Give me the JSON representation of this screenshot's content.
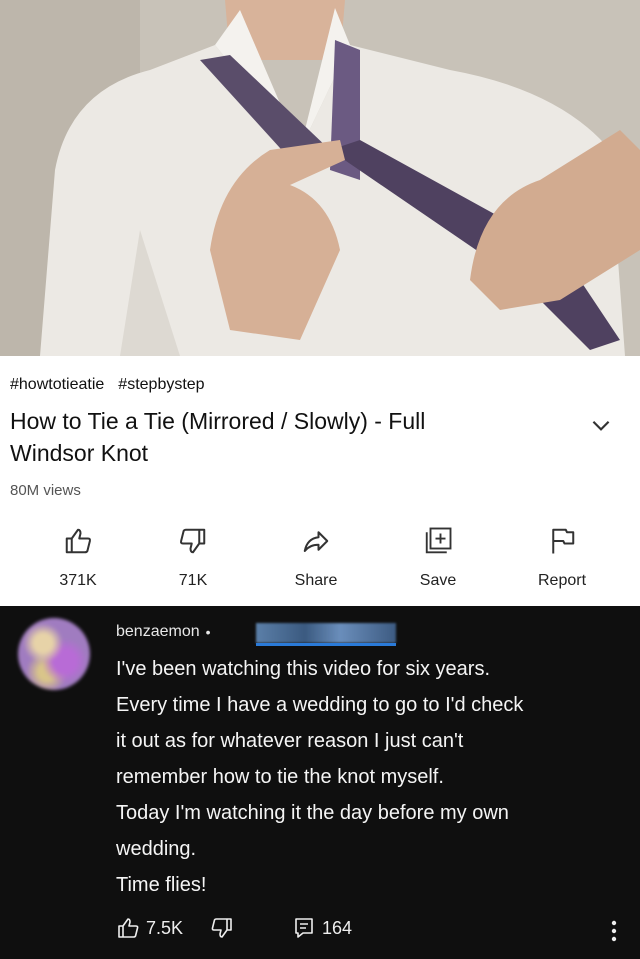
{
  "video": {
    "hashtags": [
      "#howtotieatie",
      "#stepbystep"
    ],
    "title_line1": "How to Tie a Tie (Mirrored / Slowly) - Full",
    "title_line2": "Windsor Knot",
    "views": "80M views"
  },
  "actions": [
    {
      "label": "371K",
      "icon": "thumbs-up-icon"
    },
    {
      "label": "71K",
      "icon": "thumbs-down-icon"
    },
    {
      "label": "Share",
      "icon": "share-arrow-icon"
    },
    {
      "label": "Save",
      "icon": "save-playlist-icon"
    },
    {
      "label": "Report",
      "icon": "flag-icon"
    }
  ],
  "comment": {
    "author": "benzaemon",
    "separator": "•",
    "lines": [
      "I've been watching this video for six years.",
      "Every time I have a wedding to go to I'd check",
      "it out as for whatever reason I just can't",
      "remember how to tie the knot myself.",
      "Today I'm watching it the day before my own",
      "wedding.",
      "Time flies!"
    ],
    "likes": "7.5K",
    "replies": "164"
  },
  "colors": {
    "panel_light": "#ffffff",
    "panel_dark": "#0f0f0f",
    "redaction": "#2a7ad8"
  }
}
